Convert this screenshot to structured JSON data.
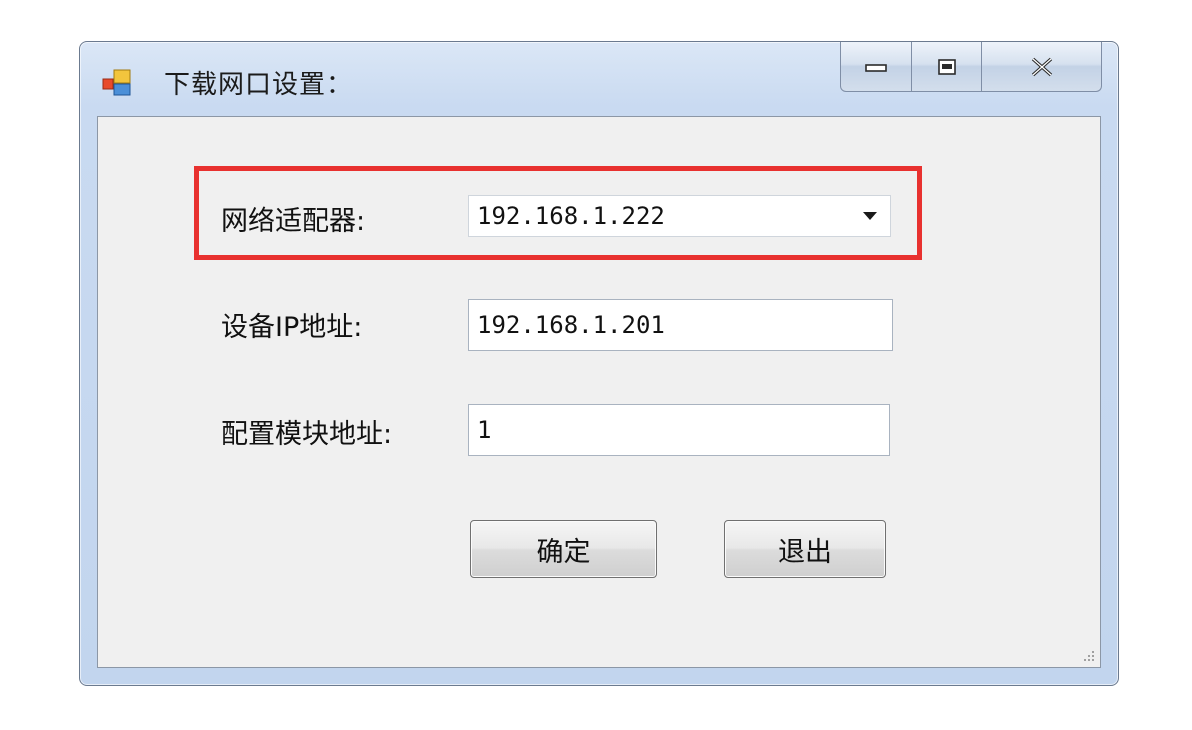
{
  "window": {
    "title": "下载网口设置：",
    "controls": {
      "minimize": "minimize",
      "maximize": "maximize",
      "close": "close"
    }
  },
  "form": {
    "adapter": {
      "label": "网络适配器:",
      "value": "192.168.1.222"
    },
    "device_ip": {
      "label": "设备IP地址:",
      "value": "192.168.1.201"
    },
    "module_address": {
      "label": "配置模块地址:",
      "value": "1"
    }
  },
  "buttons": {
    "ok": "确定",
    "exit": "退出"
  },
  "colors": {
    "highlight": "#e8312f",
    "client_bg": "#f0f0f0",
    "titlebar": "#c9daf1"
  }
}
